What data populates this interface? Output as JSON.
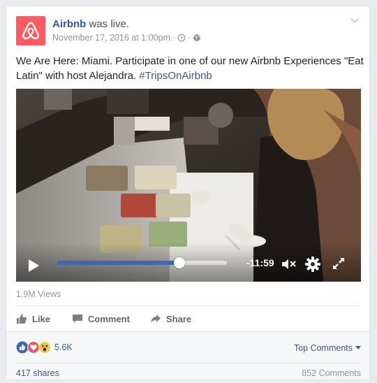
{
  "post": {
    "page_name": "Airbnb",
    "status_text": "was live.",
    "timestamp": "November 17, 2016 at 1:00pm",
    "meta_separator": "·",
    "text": "We Are Here: Miami. Participate in one of our new Airbnb Experiences \"Eat Latin\" with host Alejandra.",
    "hashtag": "#TripsOnAirbnb",
    "brand_color": "#ff5a5f",
    "link_color": "#365899"
  },
  "video": {
    "time_remaining": "-11:59",
    "progress_fraction": 0.72,
    "accent_color": "#4267b2",
    "icons": [
      "play-icon",
      "mute-icon",
      "settings-gear-icon",
      "fullscreen-icon"
    ]
  },
  "stats": {
    "views": "1.9M Views",
    "reactions_count": "5.6K",
    "reaction_icons": [
      "like-reaction-icon",
      "love-reaction-icon",
      "wow-reaction-icon"
    ],
    "shares": "417 shares",
    "comments": "852 Comments"
  },
  "actions": {
    "like": "Like",
    "comment": "Comment",
    "share": "Share"
  },
  "sort": {
    "label": "Top Comments"
  }
}
